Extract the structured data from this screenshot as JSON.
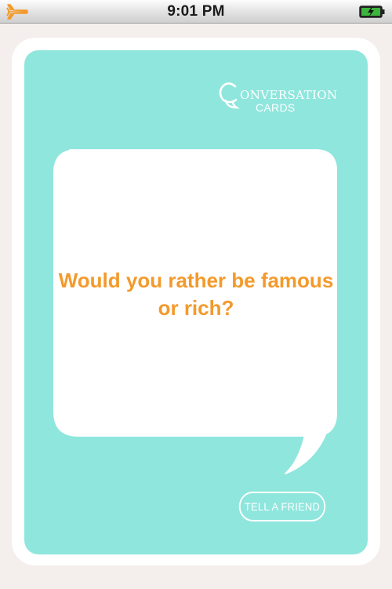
{
  "status_bar": {
    "time": "9:01 PM",
    "airplane_icon": "airplane-icon",
    "battery_icon": "battery-charging-icon",
    "accent_color": "#f39a2b",
    "battery_color": "#3cb53c"
  },
  "logo": {
    "line1": "ONVERSATION",
    "line2": "CARDS"
  },
  "card": {
    "question": "Would you rather be famous or rich?",
    "background_color": "#8fe6dd",
    "text_color": "#f39a2b"
  },
  "actions": {
    "tell_friend_label": "TELL A FRIEND"
  }
}
